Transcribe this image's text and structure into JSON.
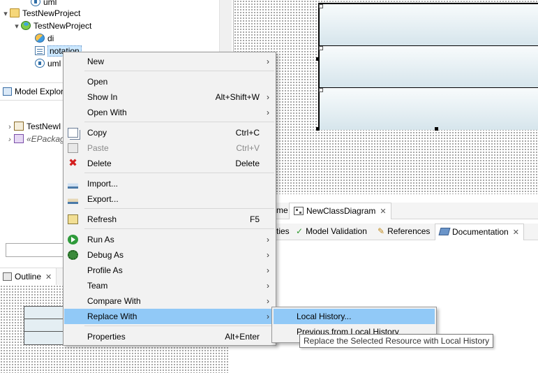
{
  "project_explorer": {
    "tree": [
      {
        "label": "uml",
        "icon": "uml-file-icon"
      },
      {
        "label": "TestNewProject",
        "icon": "folder-icon"
      },
      {
        "label": "TestNewProject",
        "icon": "papyrus-model-icon"
      },
      {
        "label": "di",
        "icon": "di-file-icon"
      },
      {
        "label": "notation",
        "icon": "notation-file-icon"
      },
      {
        "label": "uml",
        "icon": "uml-file-icon"
      }
    ]
  },
  "model_explorer": {
    "tab_label": "Model Explor",
    "items": [
      {
        "label": "TestNewI"
      },
      {
        "label": "«EPackag"
      }
    ]
  },
  "outline": {
    "tab_label": "Outline"
  },
  "editor_tabs": [
    {
      "label": "me"
    },
    {
      "label": "NewClassDiagram"
    }
  ],
  "property_tabs": [
    {
      "label": "ties"
    },
    {
      "label": "Model Validation"
    },
    {
      "label": "References"
    },
    {
      "label": "Documentation"
    }
  ],
  "context_menu": {
    "items": [
      {
        "label": "New",
        "submenu": true
      },
      {
        "label": "Open"
      },
      {
        "label": "Show In",
        "accelerator": "Alt+Shift+W",
        "submenu": true
      },
      {
        "label": "Open With",
        "submenu": true
      },
      {
        "label": "Copy",
        "accelerator": "Ctrl+C",
        "icon": "copy-icon"
      },
      {
        "label": "Paste",
        "accelerator": "Ctrl+V",
        "icon": "paste-icon",
        "disabled": true
      },
      {
        "label": "Delete",
        "accelerator": "Delete",
        "icon": "delete-icon"
      },
      {
        "label": "Import...",
        "icon": "import-icon"
      },
      {
        "label": "Export...",
        "icon": "export-icon"
      },
      {
        "label": "Refresh",
        "accelerator": "F5",
        "icon": "refresh-icon"
      },
      {
        "label": "Run As",
        "icon": "run-icon",
        "submenu": true
      },
      {
        "label": "Debug As",
        "icon": "debug-icon",
        "submenu": true
      },
      {
        "label": "Profile As",
        "submenu": true
      },
      {
        "label": "Team",
        "submenu": true
      },
      {
        "label": "Compare With",
        "submenu": true
      },
      {
        "label": "Replace With",
        "submenu": true,
        "highlighted": true
      },
      {
        "label": "Properties",
        "accelerator": "Alt+Enter"
      }
    ]
  },
  "submenu": {
    "items": [
      {
        "label": "Local History...",
        "highlighted": true
      },
      {
        "label": "Previous from Local History"
      }
    ]
  },
  "tooltip": {
    "text": "Replace the Selected Resource with Local History"
  },
  "colors": {
    "menu_highlight": "#91c9f7",
    "menu_background": "#f2f2f2",
    "delete_red": "#d42020"
  }
}
